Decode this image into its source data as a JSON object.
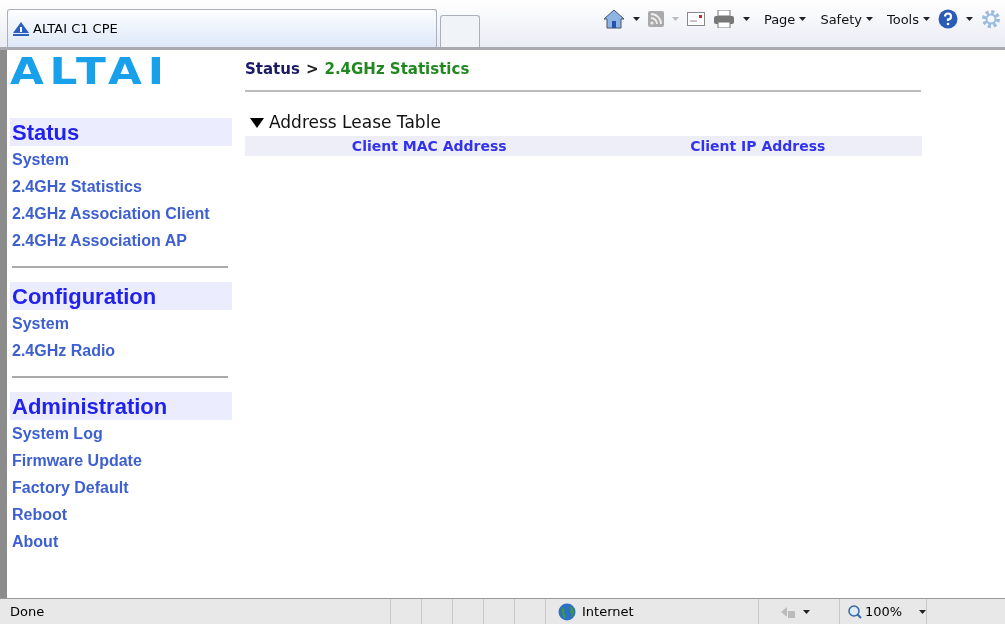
{
  "browser": {
    "tab_title": "ALTAI C1 CPE",
    "toolbar": [
      "Page",
      "Safety",
      "Tools"
    ]
  },
  "logo": "ALTAI",
  "breadcrumb": {
    "parent": "Status",
    "separator": ">",
    "current": "2.4GHz Statistics"
  },
  "sidebar": [
    {
      "heading": "Status",
      "items": [
        "System",
        "2.4GHz Statistics",
        "2.4GHz Association Client",
        "2.4GHz Association AP"
      ]
    },
    {
      "heading": "Configuration",
      "items": [
        "System",
        "2.4GHz Radio"
      ]
    },
    {
      "heading": "Administration",
      "items": [
        "System Log",
        "Firmware Update",
        "Factory Default",
        "Reboot",
        "About"
      ]
    }
  ],
  "section": {
    "title": "Address Lease Table",
    "expanded": true,
    "columns": [
      "Client MAC Address",
      "Client IP Address"
    ]
  },
  "status_bar": {
    "text": "Done",
    "zone": "Internet",
    "zoom": "100%"
  }
}
